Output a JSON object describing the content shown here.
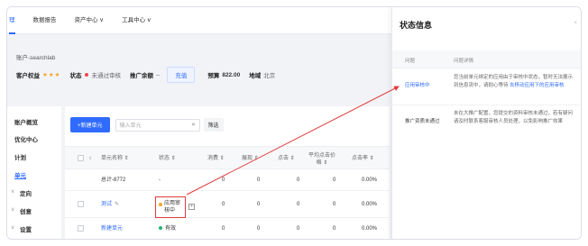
{
  "topnav": {
    "items": [
      {
        "label": "理"
      },
      {
        "label": "数据报告"
      },
      {
        "label": "资产中心 ∨"
      },
      {
        "label": "工具中心 ∨"
      }
    ]
  },
  "account": {
    "name": "账户-searchlab",
    "rights_label": "客户权益",
    "rights_stars": "★★★",
    "status_label": "状态",
    "status_value": "未通过审核",
    "balance_label": "推广余额",
    "balance_value": "--",
    "charge_button": "充值",
    "budget_label": "预算",
    "budget_value": "822.00",
    "region_label": "地域",
    "region_value": "北京"
  },
  "sidemenu": {
    "items": [
      "账户概览",
      "优化中心",
      "计划",
      "单元",
      "定向",
      "创意",
      "设置"
    ]
  },
  "toolbar": {
    "new_unit": "+新建单元",
    "search_placeholder": "输入单元",
    "filter": "筛选"
  },
  "table": {
    "headers": [
      "单元名称 ⇕",
      "状态 ⇕",
      "消费 ⇕",
      "展现 ⇕",
      "点击 ⇕",
      "平均点击价格 ⇕",
      "点击率 ⇕"
    ],
    "rows": [
      {
        "name": "总计-8772",
        "status": "-",
        "cost": "0",
        "show": "0",
        "click": "0",
        "cpc": "0",
        "ctr": "0.00%"
      },
      {
        "name": "测试",
        "status": "应用审核中",
        "cost": "0",
        "show": "0",
        "click": "0",
        "cpc": "0",
        "ctr": "0.00%"
      },
      {
        "name": "新建单元",
        "status": "有效",
        "cost": "0",
        "show": "0",
        "click": "0",
        "cpc": "0",
        "ctr": "0.00%"
      }
    ]
  },
  "panel": {
    "title": "状态信息",
    "close": "×",
    "col_problem": "问题",
    "col_detail": "问题详情",
    "rows": [
      {
        "label": "应用审核中",
        "text": "您当前单元绑定的应用由于审核中状态，暂时无法展示到信息流中，请耐心等待",
        "link": "去移动应用下的应用审核"
      },
      {
        "label": "推广资质未通过",
        "text": "未在大推广配置，您提交的资料审核未通过，若有疑问请及时联系客服审核人员处理，以免影响推广效果"
      }
    ]
  },
  "colors": {
    "accent": "#2f6bff",
    "warn": "#f5a623",
    "error": "#e03c3c",
    "success": "#22b573"
  }
}
